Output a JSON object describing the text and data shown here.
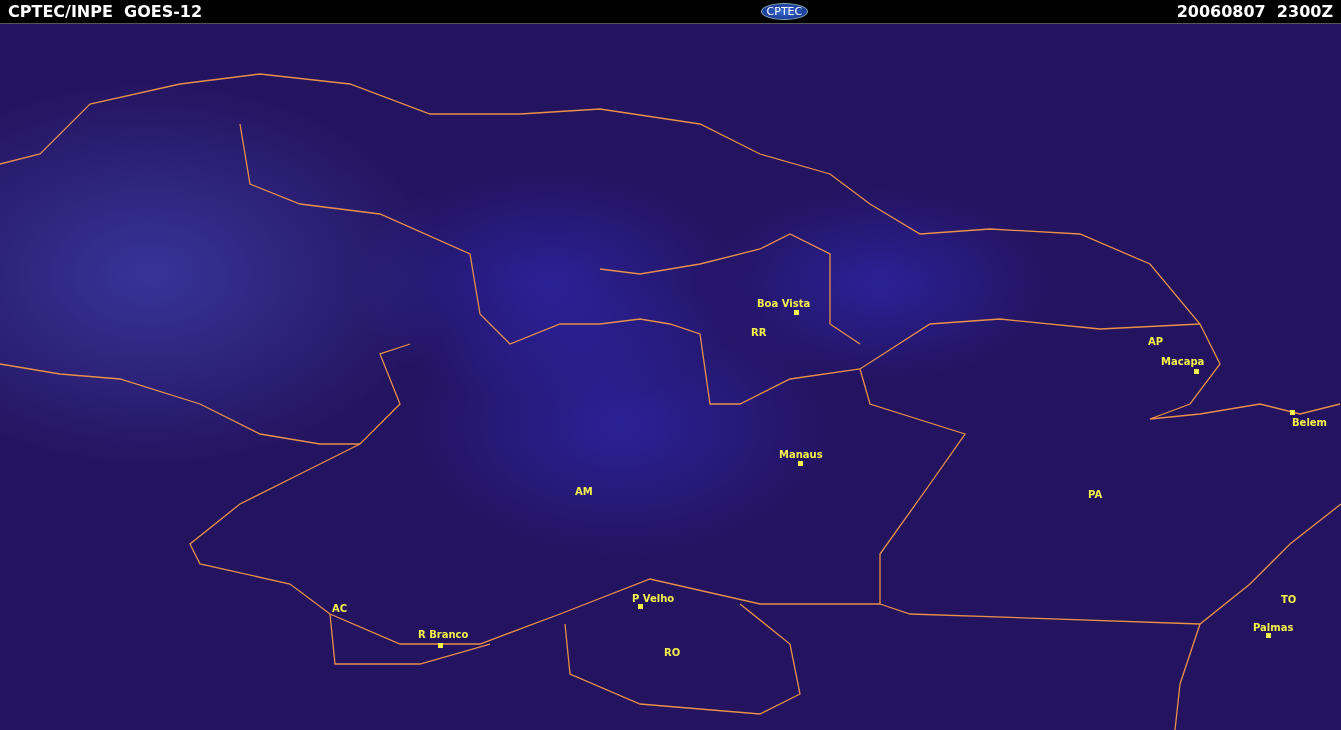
{
  "header": {
    "title": "CPTEC/INPE  GOES-12",
    "logo": "CPTEC",
    "timestamp": "20060807  2300Z"
  },
  "map": {
    "regions": [
      "RR",
      "AP",
      "AM",
      "PA",
      "AC",
      "RO",
      "TO"
    ],
    "cities": [
      {
        "name": "Boa Vista"
      },
      {
        "name": "Macapa"
      },
      {
        "name": "Belem"
      },
      {
        "name": "Manaus"
      },
      {
        "name": "P Velho"
      },
      {
        "name": "R Branco"
      },
      {
        "name": "Palmas"
      }
    ]
  }
}
